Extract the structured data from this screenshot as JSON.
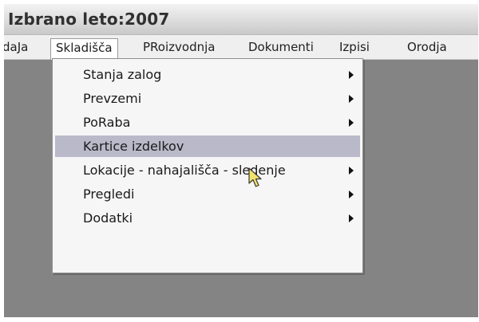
{
  "title": {
    "label": "Izbrano leto:",
    "year": "2007"
  },
  "menubar": {
    "items": [
      {
        "label": "daJa",
        "open": false
      },
      {
        "label": "Skladišča",
        "open": true
      },
      {
        "label": "PRoizvodnja",
        "open": false
      },
      {
        "label": "Dokumenti",
        "open": false
      },
      {
        "label": "Izpisi",
        "open": false
      },
      {
        "label": "Orodja",
        "open": false
      }
    ]
  },
  "dropdown": {
    "items": [
      {
        "label": "Stanja zalog",
        "submenu": true,
        "highlighted": false
      },
      {
        "label": "Prevzemi",
        "submenu": true,
        "highlighted": false
      },
      {
        "label": "PoRaba",
        "submenu": true,
        "highlighted": false
      },
      {
        "label": "Kartice izdelkov",
        "submenu": false,
        "highlighted": true
      },
      {
        "label": "Lokacije - nahajališča - sledenje",
        "submenu": true,
        "highlighted": false
      },
      {
        "label": "Pregledi",
        "submenu": true,
        "highlighted": false
      },
      {
        "label": "Dodatki",
        "submenu": true,
        "highlighted": false
      }
    ]
  },
  "icons": {
    "submenu_arrow": "chevron-right-icon",
    "cursor": "mouse-pointer-icon"
  },
  "colors": {
    "workspace": "#848484",
    "highlight": "#b9b9c9",
    "menu_background": "#f6f6f6",
    "cursor_fill": "#f2e26a"
  }
}
